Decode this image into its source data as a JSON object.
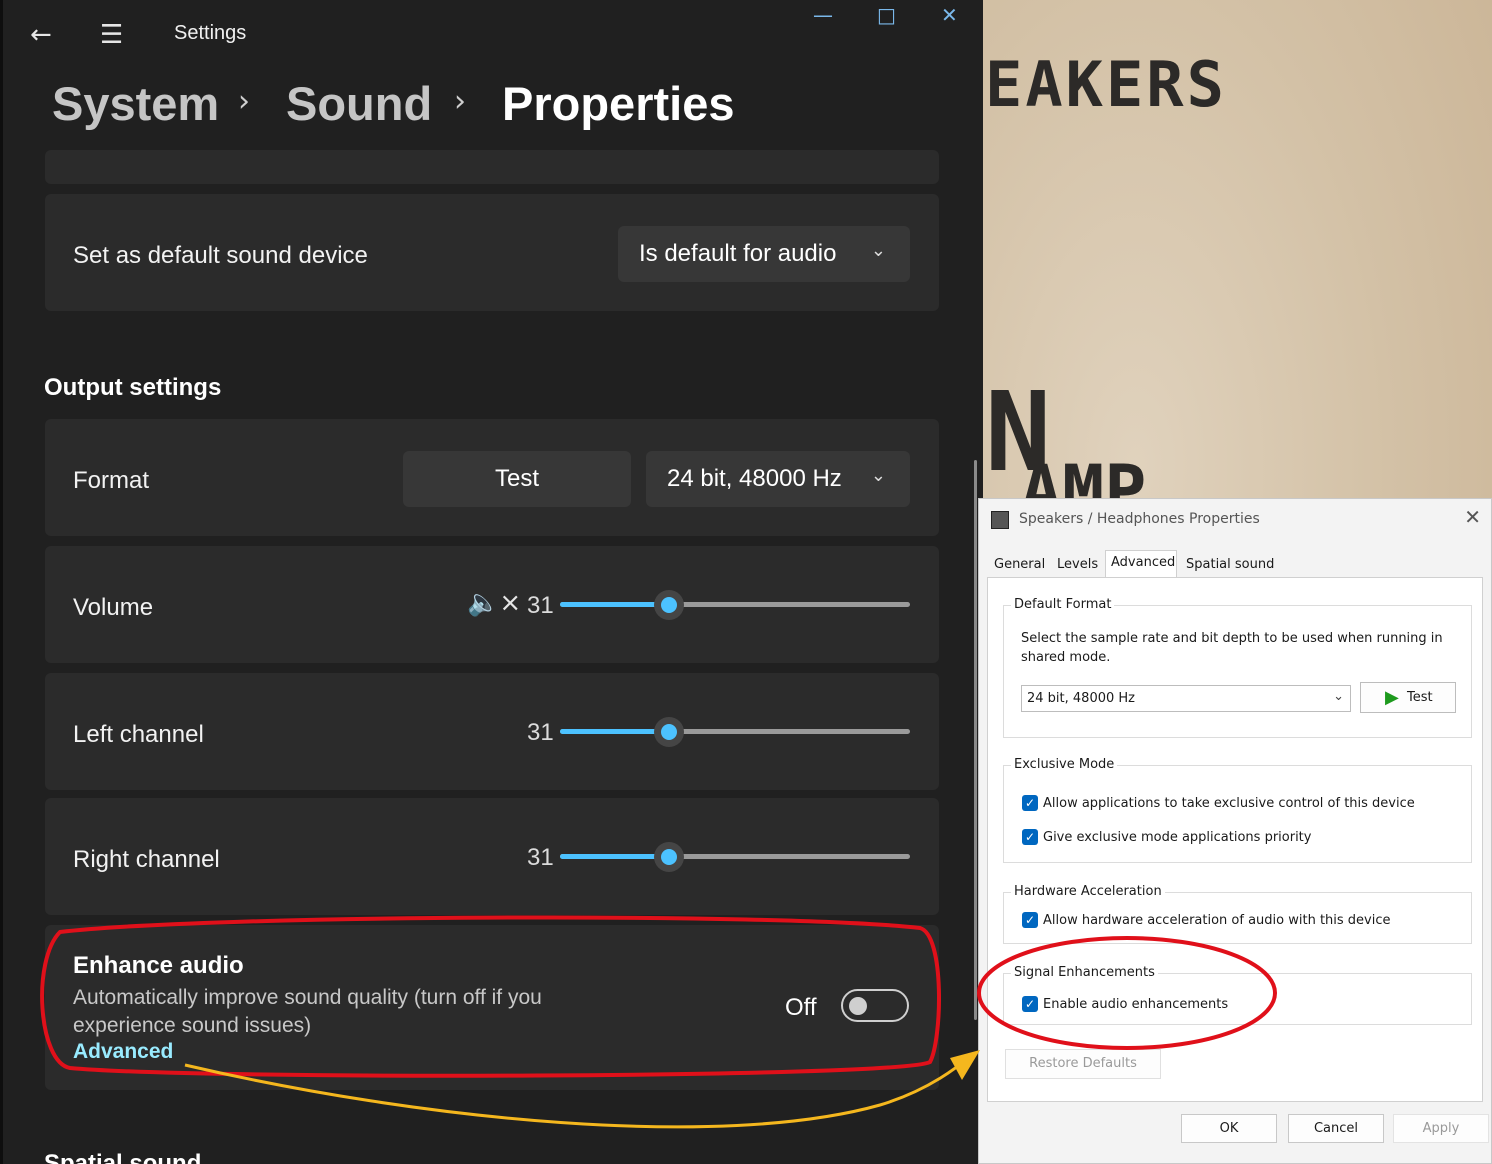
{
  "background": {
    "text_top": "EAKERS",
    "text_mid": "N",
    "text_bottom": "AMP"
  },
  "settings": {
    "app_title": "Settings",
    "breadcrumb": [
      "System",
      "Sound",
      "Properties"
    ],
    "default_device": {
      "label": "Set as default sound device",
      "value": "Is default for audio"
    },
    "output_section_title": "Output settings",
    "format": {
      "label": "Format",
      "test_label": "Test",
      "value": "24 bit, 48000 Hz"
    },
    "volume": {
      "label": "Volume",
      "value": "31",
      "level_percent": 31
    },
    "left_channel": {
      "label": "Left channel",
      "value": "31",
      "level_percent": 31
    },
    "right_channel": {
      "label": "Right channel",
      "value": "31",
      "level_percent": 31
    },
    "enhance": {
      "title": "Enhance audio",
      "description": "Automatically improve sound quality (turn off if you experience sound issues)",
      "link": "Advanced",
      "state_label": "Off",
      "enabled": false
    },
    "next_section_title": "Spatial sound"
  },
  "dialog": {
    "title": "Speakers / Headphones Properties",
    "tabs": [
      "General",
      "Levels",
      "Advanced",
      "Spatial sound"
    ],
    "active_tab": "Advanced",
    "default_format": {
      "group": "Default Format",
      "description": "Select the sample rate and bit depth to be used when running in shared mode.",
      "value": "24 bit, 48000 Hz",
      "test_label": "Test"
    },
    "exclusive": {
      "group": "Exclusive Mode",
      "option1": "Allow applications to take exclusive control of this device",
      "option2": "Give exclusive mode applications priority"
    },
    "hardware": {
      "group": "Hardware Acceleration",
      "option1": "Allow hardware acceleration of audio with this device"
    },
    "signal": {
      "group": "Signal Enhancements",
      "option1": "Enable audio enhancements"
    },
    "restore_label": "Restore Defaults",
    "ok_label": "OK",
    "cancel_label": "Cancel",
    "apply_label": "Apply"
  },
  "colors": {
    "accent": "#4cc2ff",
    "highlight_circle": "#e0101a",
    "arrow": "#f5b71e",
    "checkbox": "#0067c0"
  }
}
